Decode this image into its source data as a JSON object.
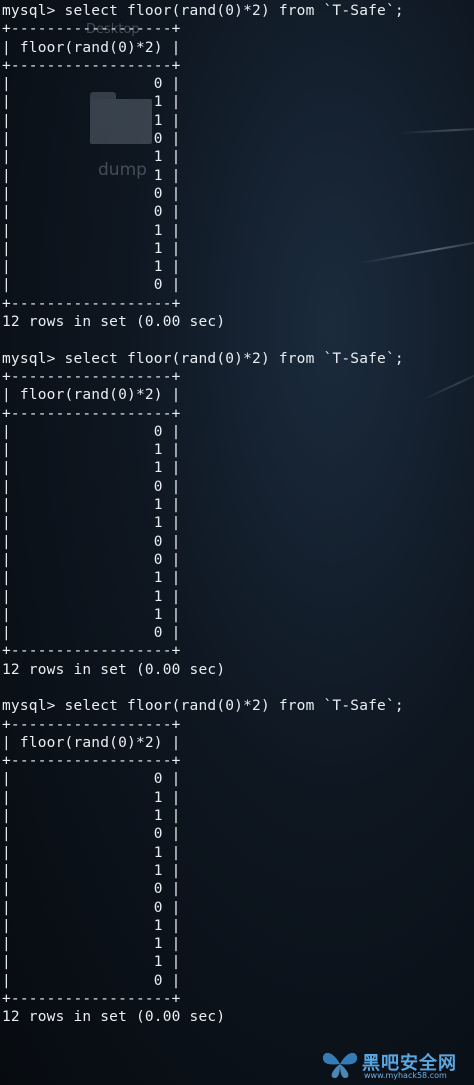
{
  "desktop": {
    "label_top": "Desktop",
    "folder_label": "dump"
  },
  "terminal": {
    "queries": [
      {
        "prompt": "mysql> select floor(rand(0)*2) from `T-Safe`;",
        "border": "+------------------+",
        "header": "| floor(rand(0)*2) |",
        "rows": [
          "|                0 |",
          "|                1 |",
          "|                1 |",
          "|                0 |",
          "|                1 |",
          "|                1 |",
          "|                0 |",
          "|                0 |",
          "|                1 |",
          "|                1 |",
          "|                1 |",
          "|                0 |"
        ],
        "result": "12 rows in set (0.00 sec)"
      },
      {
        "prompt": "mysql> select floor(rand(0)*2) from `T-Safe`;",
        "border": "+------------------+",
        "header": "| floor(rand(0)*2) |",
        "rows": [
          "|                0 |",
          "|                1 |",
          "|                1 |",
          "|                0 |",
          "|                1 |",
          "|                1 |",
          "|                0 |",
          "|                0 |",
          "|                1 |",
          "|                1 |",
          "|                1 |",
          "|                0 |"
        ],
        "result": "12 rows in set (0.00 sec)"
      },
      {
        "prompt": "mysql> select floor(rand(0)*2) from `T-Safe`;",
        "border": "+------------------+",
        "header": "| floor(rand(0)*2) |",
        "rows": [
          "|                0 |",
          "|                1 |",
          "|                1 |",
          "|                0 |",
          "|                1 |",
          "|                1 |",
          "|                0 |",
          "|                0 |",
          "|                1 |",
          "|                1 |",
          "|                1 |",
          "|                0 |"
        ],
        "result": "12 rows in set (0.00 sec)"
      }
    ]
  },
  "watermark": {
    "title": "黑吧安全网",
    "url": "www.myhack58.com"
  }
}
